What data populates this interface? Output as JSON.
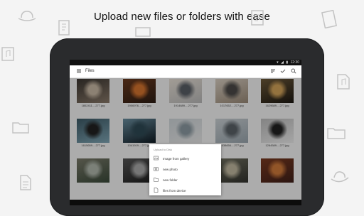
{
  "headline": "Upload new files or folders with ease",
  "status_bar": {
    "time": "12:30"
  },
  "app_bar": {
    "title": "Files"
  },
  "files": [
    {
      "name": "1802411....277.jpg",
      "colors": [
        "#8a7a6a",
        "#c9b9a5",
        "#3a3530"
      ]
    },
    {
      "name": "1906976....277.jpg",
      "colors": [
        "#2d1d14",
        "#d6742e",
        "#6a3a1e"
      ]
    },
    {
      "name": "1914689....277.jpg",
      "colors": [
        "#b9b9b9",
        "#5a5f66",
        "#e8e0d6"
      ]
    },
    {
      "name": "1017652....277.jpg",
      "colors": [
        "#9a8a78",
        "#4c4a48",
        "#d9cfc2"
      ]
    },
    {
      "name": "1629689....277.jpg",
      "colors": [
        "#1c1812",
        "#d3a45a",
        "#6e5a3a"
      ]
    },
    {
      "name": "1615659....277.jpg",
      "colors": [
        "#7fa6b5",
        "#222",
        "#3d5a66"
      ]
    },
    {
      "name": "1041919....277.jpg",
      "colors": [
        "#0f1a22",
        "#2f4a55",
        "#6a8fa0"
      ]
    },
    {
      "name": "1000869....277.jpg",
      "colors": [
        "#e8e8e8",
        "#8c9aa2",
        "#cfd6da"
      ]
    },
    {
      "name": "1638656....277.jpg",
      "colors": [
        "#9aa6ae",
        "#5b6268",
        "#cbd1d5"
      ]
    },
    {
      "name": "1264589....277.jpg",
      "colors": [
        "#ececec",
        "#222",
        "#bdbdbd"
      ]
    },
    {
      "name": "",
      "colors": [
        "#3a4a3a",
        "#b1b8ad",
        "#7a7a6a"
      ]
    },
    {
      "name": "",
      "colors": [
        "#1e1e1e",
        "#aaaaaa",
        "#555555"
      ]
    },
    {
      "name": "",
      "colors": [
        "#bcbcbc",
        "#5a5a5a",
        "#e1e1e1"
      ]
    },
    {
      "name": "",
      "colors": [
        "#33332e",
        "#c0b8a0",
        "#707060"
      ]
    },
    {
      "name": "",
      "colors": [
        "#40201a",
        "#d07a3a",
        "#7a3a20"
      ]
    }
  ],
  "upload_sheet": {
    "title": "Upload to Disk",
    "items": [
      {
        "label": "Image from gallery",
        "icon": "image-icon"
      },
      {
        "label": "new photo",
        "icon": "camera-icon"
      },
      {
        "label": "new folder",
        "icon": "folder-icon"
      },
      {
        "label": "files from device",
        "icon": "file-icon"
      }
    ]
  },
  "theme": {
    "accent": "#1e88e5",
    "screen_bg": "#f7f7f7",
    "deco": "#c3c3c3"
  }
}
